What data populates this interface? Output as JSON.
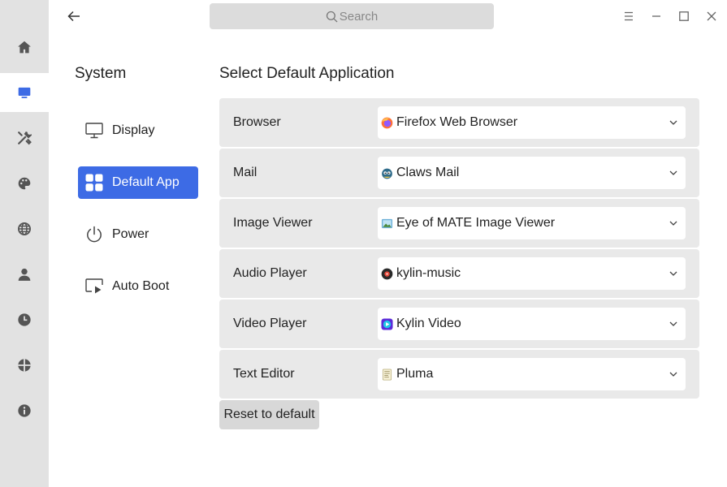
{
  "search": {
    "placeholder": "Search"
  },
  "sidebar": {
    "title": "System",
    "items": [
      {
        "label": "Display",
        "icon": "monitor-icon",
        "active": false
      },
      {
        "label": "Default App",
        "icon": "grid-icon",
        "active": true
      },
      {
        "label": "Power",
        "icon": "power-icon",
        "active": false
      },
      {
        "label": "Auto Boot",
        "icon": "auto-boot-icon",
        "active": false
      }
    ]
  },
  "rail": [
    "home-icon",
    "system-icon",
    "devices-icon",
    "personalize-icon",
    "network-icon",
    "account-icon",
    "datetime-icon",
    "update-icon",
    "about-icon"
  ],
  "main": {
    "title": "Select Default Application",
    "rows": [
      {
        "label": "Browser",
        "value": "Firefox Web Browser",
        "icon": "firefox-icon"
      },
      {
        "label": "Mail",
        "value": "Claws Mail",
        "icon": "claws-mail-icon"
      },
      {
        "label": "Image Viewer",
        "value": "Eye of MATE Image Viewer",
        "icon": "image-viewer-icon"
      },
      {
        "label": "Audio Player",
        "value": "kylin-music",
        "icon": "music-icon"
      },
      {
        "label": "Video Player",
        "value": "Kylin Video",
        "icon": "video-icon"
      },
      {
        "label": "Text Editor",
        "value": "Pluma",
        "icon": "text-editor-icon"
      }
    ],
    "reset_label": "Reset to default"
  },
  "colors": {
    "accent": "#3d6be5",
    "rail_bg": "#e2e2e2",
    "row_bg": "#e9e9e9"
  }
}
